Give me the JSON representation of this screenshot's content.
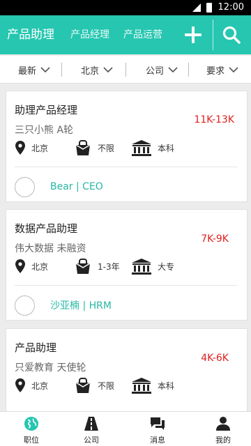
{
  "status_bar": {
    "time": "12:00"
  },
  "app_bar": {
    "tabs": [
      {
        "label": "产品助理"
      },
      {
        "label": "产品经理"
      },
      {
        "label": "产品运营"
      }
    ]
  },
  "filters": [
    {
      "label": "最新"
    },
    {
      "label": "北京"
    },
    {
      "label": "公司"
    },
    {
      "label": "要求"
    }
  ],
  "jobs": [
    {
      "title": "助理产品经理",
      "company": "三只小熊  A轮",
      "salary": "11K-13K",
      "location": "北京",
      "experience": "不限",
      "education": "本科",
      "contact": "Bear | CEO"
    },
    {
      "title": "数据产品助理",
      "company": "伟大数据  未融资",
      "salary": "7K-9K",
      "location": "北京",
      "experience": "1-3年",
      "education": "大专",
      "contact": "沙亚楠 | HRM"
    },
    {
      "title": "产品助理",
      "company": "只爱教育  天使轮",
      "salary": "4K-6K",
      "location": "北京",
      "experience": "不限",
      "education": "本科"
    }
  ],
  "bottom_nav": [
    {
      "label": "职位",
      "icon": "globe-icon"
    },
    {
      "label": "公司",
      "icon": "road-icon"
    },
    {
      "label": "消息",
      "icon": "chat-icon"
    },
    {
      "label": "我的",
      "icon": "person-icon"
    }
  ],
  "colors": {
    "accent": "#26c6b0",
    "salary": "#e02020",
    "contact": "#26b8a4"
  }
}
